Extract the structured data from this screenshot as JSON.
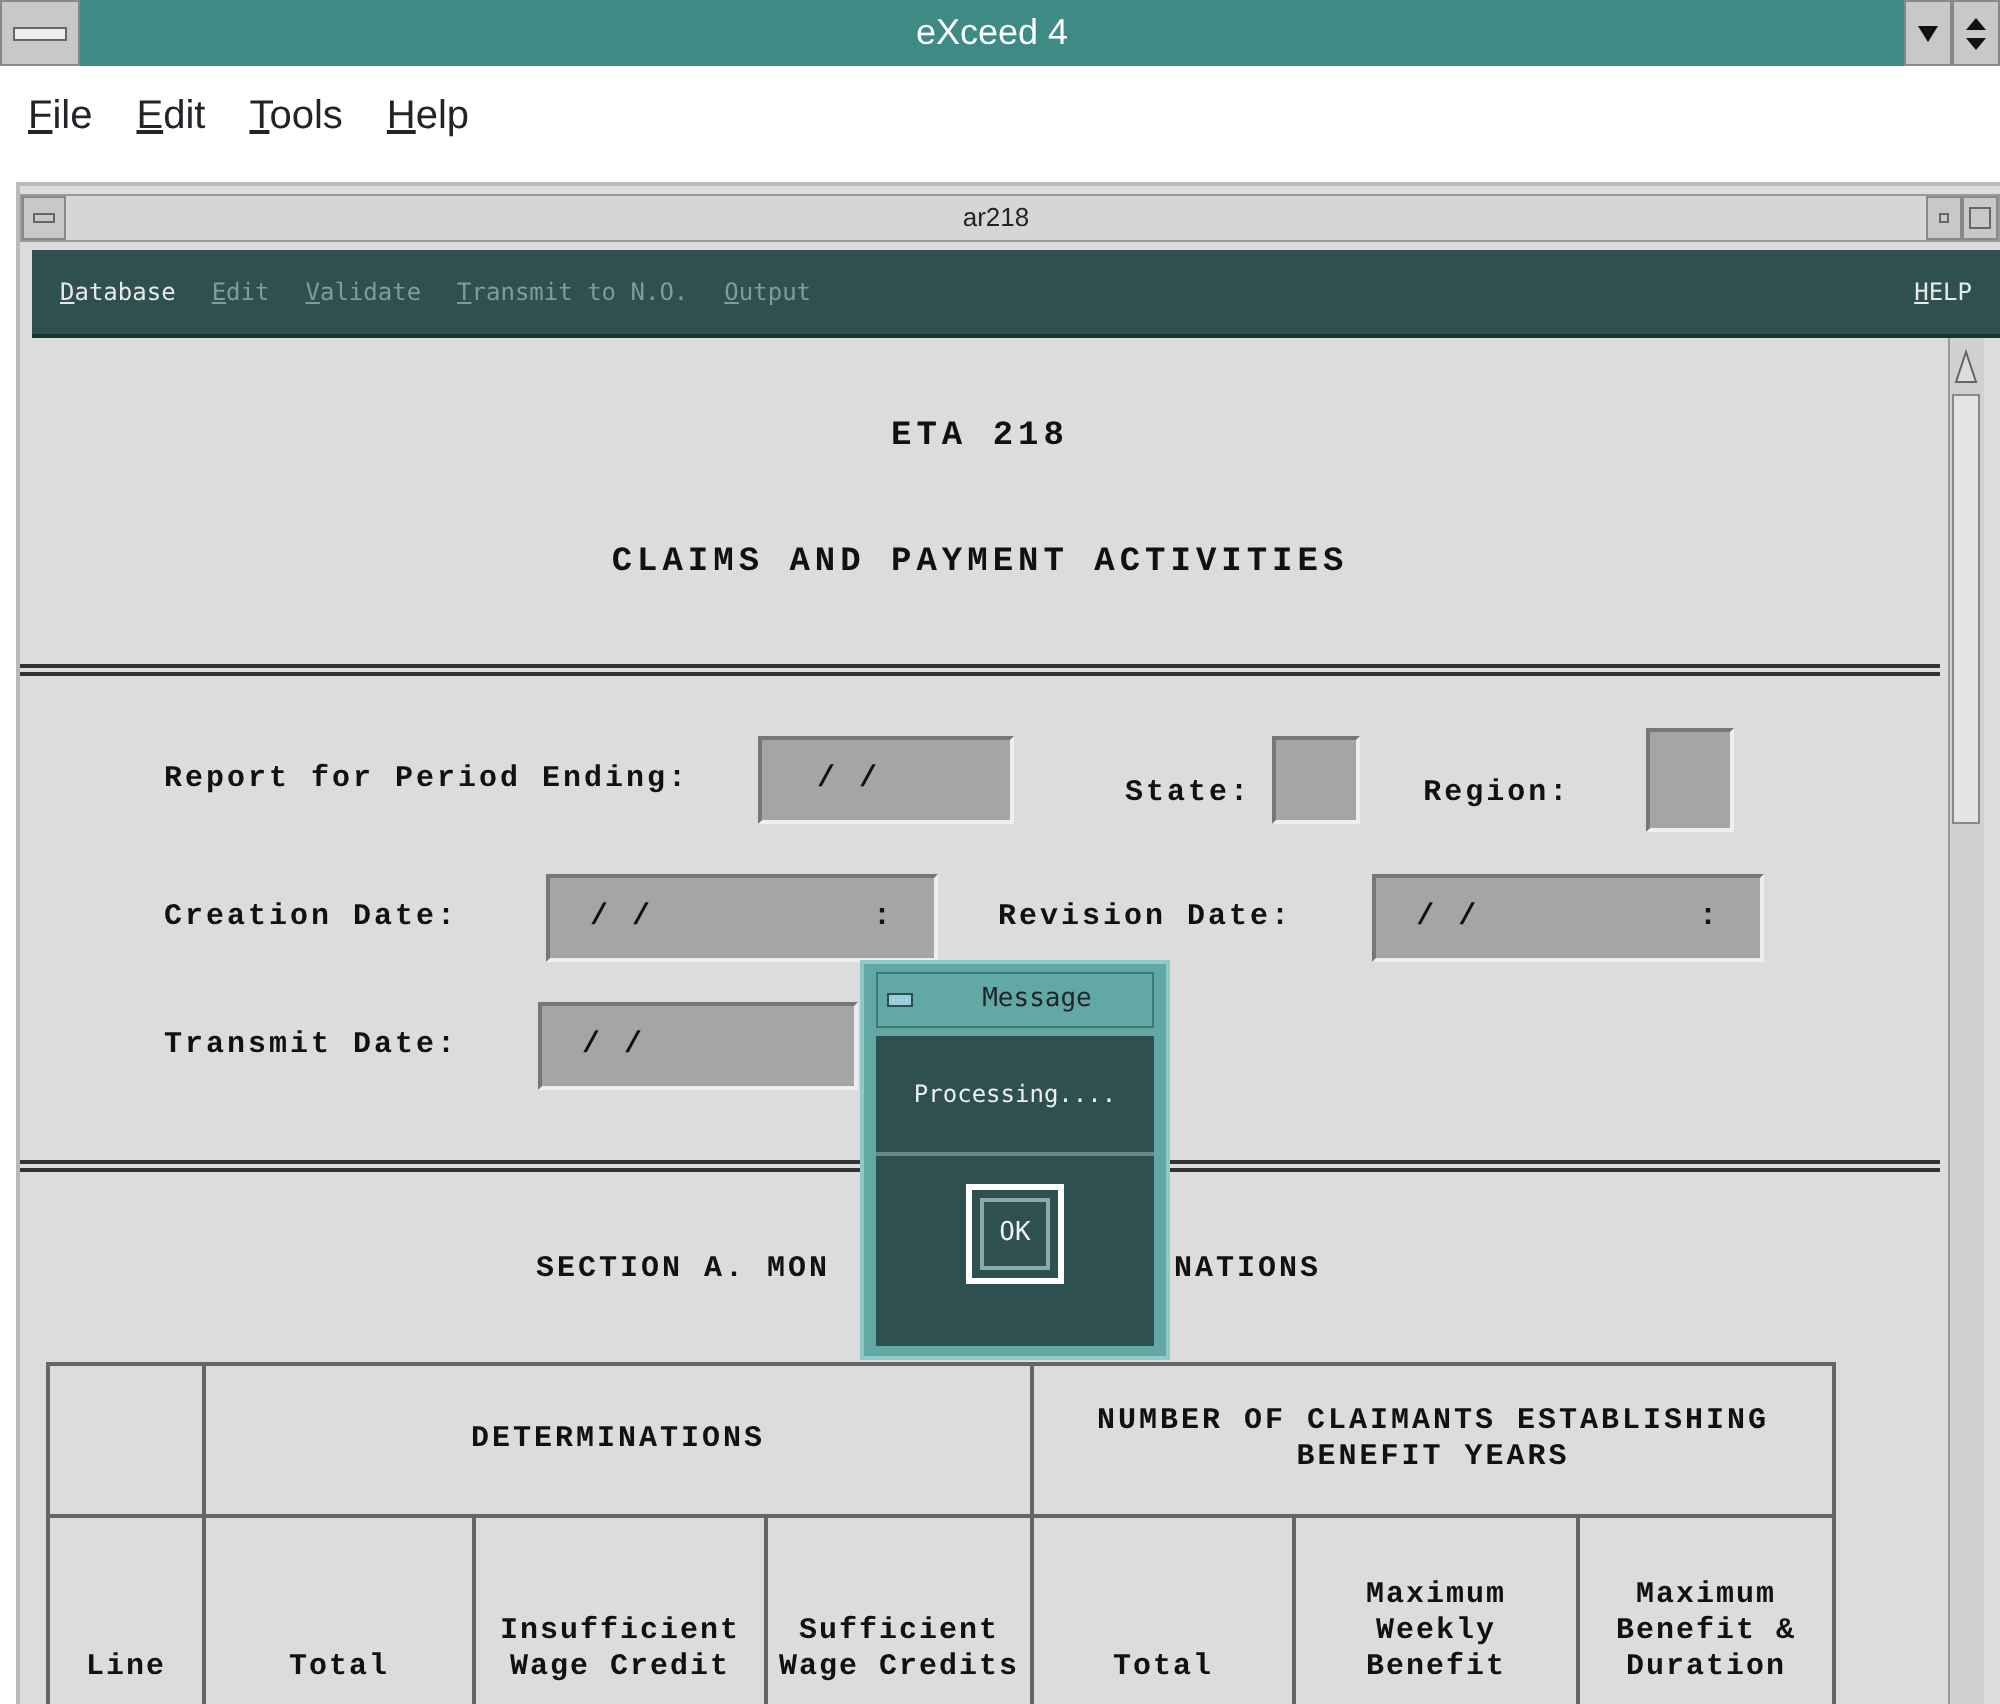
{
  "window": {
    "title": "eXceed 4"
  },
  "menu": [
    {
      "label": "File"
    },
    {
      "label": "Edit"
    },
    {
      "label": "Tools"
    },
    {
      "label": "Help"
    }
  ],
  "document": {
    "title": "ar218",
    "toolbar": [
      {
        "label": "Database",
        "disabled": false
      },
      {
        "label": "Edit",
        "disabled": true
      },
      {
        "label": "Validate",
        "disabled": true
      },
      {
        "label": "Transmit to N.O.",
        "disabled": true
      },
      {
        "label": "Output",
        "disabled": true
      }
    ],
    "help": "HELP",
    "form_title": "ETA 218",
    "form_subtitle": "CLAIMS AND PAYMENT ACTIVITIES",
    "fields": [
      {
        "label": "Report for Period Ending:",
        "value": "/ /"
      },
      {
        "label": "State:"
      },
      {
        "label": "Region:"
      },
      {
        "label": "Creation Date:",
        "value": "/ /",
        "time": ":"
      },
      {
        "label": "Revision Date:",
        "value": "/ /",
        "time": ":"
      },
      {
        "label": "Transmit Date:",
        "value": "/ /"
      }
    ],
    "section_heading_left": "SECTION A. MON",
    "section_heading_right": "NATIONS",
    "table": {
      "groups": [
        "DETERMINATIONS",
        "NUMBER OF CLAIMANTS ESTABLISHING BENEFIT YEARS"
      ],
      "columns": [
        "Line",
        "Total",
        "Insufficient Wage Credit",
        "Sufficient Wage Credits",
        "Total",
        "Maximum Weekly Benefit",
        "Maximum Benefit & Duration"
      ]
    }
  },
  "dialog": {
    "title": "Message",
    "text": "Processing....",
    "button": "OK"
  }
}
